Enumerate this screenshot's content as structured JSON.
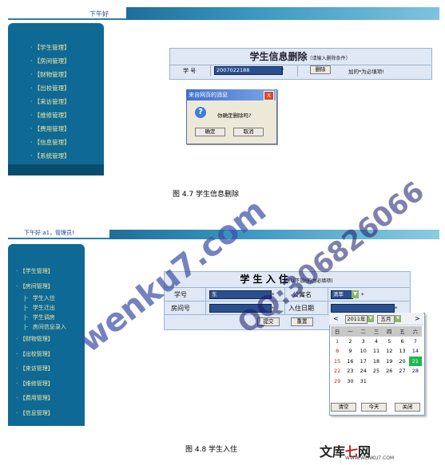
{
  "screen1": {
    "greeting": "下午好",
    "menu": [
      "【学生管理】",
      "【房间管理】",
      "【财物管理】",
      "【出校管理】",
      "【来访管理】",
      "【维修管理】",
      "【费用管理】",
      "【信息管理】",
      "【系统管理】"
    ],
    "form": {
      "title": "学生信息删除",
      "subtitle": "（请输入删除条件）",
      "field_label": "学 号",
      "field_value": "2007022188",
      "required_mark": "*",
      "delete_button": "删除",
      "note": "加的*为必填项!"
    },
    "dialog": {
      "title": "来自网页的消息",
      "close": "X",
      "icon": "?",
      "message": "你确定删除吗?",
      "ok": "确定",
      "cancel": "取消"
    },
    "caption": "图 4.7 学生信息删除"
  },
  "screen2": {
    "greeting": "下午好:a1，管理员!",
    "menu": [
      {
        "label": "【学生管理】",
        "sub": false
      },
      {
        "label": "【房间管理】",
        "sub": false
      },
      {
        "label": "学生入住",
        "sub": true
      },
      {
        "label": "学生迁出",
        "sub": true
      },
      {
        "label": "学生调房",
        "sub": true
      },
      {
        "label": "房间信息录入",
        "sub": true
      },
      {
        "label": "【财物管理】",
        "sub": false
      },
      {
        "label": "【出校管理】",
        "sub": false
      },
      {
        "label": "【来访管理】",
        "sub": false
      },
      {
        "label": "【维修管理】",
        "sub": false
      },
      {
        "label": "【费用管理】",
        "sub": false
      },
      {
        "label": "【信息管理】",
        "sub": false
      }
    ],
    "form": {
      "title": "学 生 入 住",
      "subtitle": "(以下加*的为必填项)",
      "student_id_label": "学号",
      "student_id_value": "东",
      "dorm_label": "公寓名",
      "dorm_value": "清萃",
      "room_label": "房间号",
      "room_value": "",
      "date_label": "入住日期",
      "date_value": "",
      "required_mark": "*",
      "submit": "提交",
      "reset": "重置"
    },
    "calendar": {
      "prev": "<",
      "next": ">",
      "year": "2011年",
      "month": "五月",
      "weekdays": [
        "日",
        "一",
        "二",
        "三",
        "四",
        "五",
        "六"
      ],
      "weeks": [
        [
          "1",
          "2",
          "3",
          "4",
          "5",
          "6",
          "7"
        ],
        [
          "8",
          "9",
          "10",
          "11",
          "12",
          "13",
          "14"
        ],
        [
          "15",
          "16",
          "17",
          "18",
          "19",
          "20",
          "21"
        ],
        [
          "22",
          "23",
          "24",
          "25",
          "26",
          "27",
          "28"
        ],
        [
          "29",
          "30",
          "31",
          "",
          "",
          "",
          ""
        ]
      ],
      "today": "21",
      "clear": "清空",
      "today_btn": "今天",
      "close": "关闭"
    },
    "caption": "图 4.8  学生入住"
  },
  "watermark": {
    "left": "wenku7.com",
    "right": "QQ:306826066"
  },
  "logo": {
    "brand_a": "文库",
    "brand_b": "七",
    "brand_c": "网",
    "url": "WWW.WENKU7.COM"
  },
  "colors": {
    "sidebar": "#0e6a94",
    "menu_text": "#f3e7a5",
    "form_bg": "#dfe8f4",
    "input_bg": "#2a4f8c",
    "today": "#1fb84a"
  }
}
